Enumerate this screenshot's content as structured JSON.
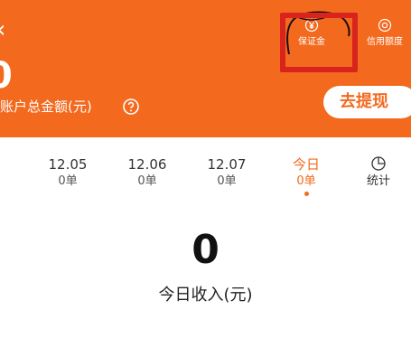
{
  "header": {
    "back_icon": "‹",
    "balance_value": "0",
    "balance_label": "账户总金额(元)",
    "background_color": "#f36a1f"
  },
  "actions": {
    "deposit": {
      "label": "保证金",
      "icon": "yen-shield-icon"
    },
    "credit": {
      "label": "信用额度",
      "icon": "target-icon"
    }
  },
  "withdraw": {
    "label": "去提现"
  },
  "dates": {
    "items": [
      {
        "date": "12.05",
        "orders": "0单"
      },
      {
        "date": "12.06",
        "orders": "0单"
      },
      {
        "date": "12.07",
        "orders": "0单"
      },
      {
        "date": "今日",
        "orders": "0单"
      }
    ],
    "stats_label": "统计"
  },
  "income": {
    "value": "0",
    "label": "今日收入(元)"
  },
  "colors": {
    "accent": "#f36a1f",
    "annotation": "#d8241c"
  }
}
